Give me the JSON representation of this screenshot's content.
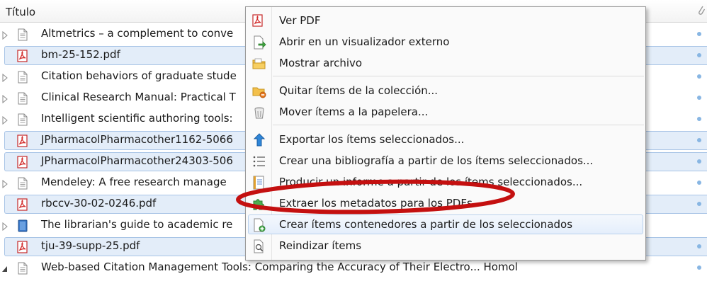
{
  "list": {
    "column_title": "Título",
    "rows": [
      {
        "label": "Altmetrics – a complement to conve",
        "icon": "document-icon",
        "twisty": "collapsed",
        "selected": false,
        "dot": true
      },
      {
        "label": "bm-25-152.pdf",
        "icon": "pdf-icon",
        "twisty": "none",
        "selected": true,
        "dot": true
      },
      {
        "label": "Citation behaviors of graduate stude",
        "icon": "document-icon",
        "twisty": "collapsed",
        "selected": false,
        "dot": true
      },
      {
        "label": "Clinical Research Manual: Practical T",
        "icon": "document-icon",
        "twisty": "collapsed",
        "selected": false,
        "dot": true
      },
      {
        "label": "Intelligent scientific authoring tools:",
        "icon": "document-icon",
        "twisty": "collapsed",
        "selected": false,
        "dot": true
      },
      {
        "label": "JPharmacolPharmacother1162-5066",
        "icon": "pdf-icon",
        "twisty": "none",
        "selected": true,
        "dot": true
      },
      {
        "label": "JPharmacolPharmacother24303-506",
        "icon": "pdf-icon",
        "twisty": "none",
        "selected": true,
        "dot": true
      },
      {
        "label": "Mendeley: A free research manage",
        "icon": "document-icon",
        "twisty": "collapsed",
        "selected": false,
        "dot": true
      },
      {
        "label": "rbccv-30-02-0246.pdf",
        "icon": "pdf-icon",
        "twisty": "none",
        "selected": true,
        "dot": true
      },
      {
        "label": "The librarian's guide to academic re",
        "icon": "book-icon",
        "twisty": "collapsed",
        "selected": false,
        "dot": false
      },
      {
        "label": "tju-39-supp-25.pdf",
        "icon": "pdf-icon",
        "twisty": "none",
        "selected": true,
        "dot": true
      },
      {
        "label": "Web-based Citation Management Tools: Comparing the Accuracy of Their Electro...  Homol",
        "icon": "document-icon",
        "twisty": "expanded",
        "selected": false,
        "dot": true
      }
    ]
  },
  "menu": {
    "items": [
      {
        "label": "Ver PDF",
        "icon": "pdf-icon"
      },
      {
        "label": "Abrir en un visualizador externo",
        "icon": "open-external-icon"
      },
      {
        "label": "Mostrar archivo",
        "icon": "folder-icon"
      },
      {
        "label": "Quitar ítems de la colección...",
        "icon": "remove-from-collection-icon"
      },
      {
        "label": "Mover ítems a la papelera...",
        "icon": "trash-icon"
      },
      {
        "label": "Exportar los ítems seleccionados...",
        "icon": "export-icon"
      },
      {
        "label": "Crear una bibliografía a partir de los ítems seleccionados...",
        "icon": "bibliography-icon"
      },
      {
        "label": "Producir un informe a partir de los ítems seleccionados...",
        "icon": "report-icon"
      },
      {
        "label": "Extraer los metadatos para los PDFs",
        "icon": "puzzle-icon"
      },
      {
        "label": "Crear ítems contenedores a partir de los seleccionados",
        "icon": "create-parent-icon"
      },
      {
        "label": "Reindizar ítems",
        "icon": "reindex-icon"
      }
    ],
    "hovered_index": 9
  },
  "colors": {
    "selection_fill": "#e3edf9",
    "selection_border": "#a8c4e6",
    "annotation_ellipse": "#c41010",
    "status_dot": "#88b6e3"
  }
}
